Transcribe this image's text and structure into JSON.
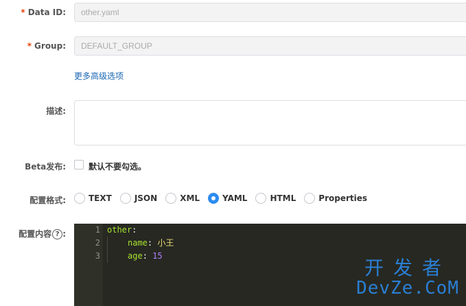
{
  "form": {
    "data_id": {
      "required_mark": "*",
      "label": "Data ID:",
      "value": "other.yaml"
    },
    "group": {
      "required_mark": "*",
      "label": "Group:",
      "value": "DEFAULT_GROUP"
    },
    "advanced_link": "更多高级选项",
    "description": {
      "label": "描述:"
    },
    "beta": {
      "label": "Beta发布:",
      "checkbox_label": "默认不要勾选。",
      "checked": false
    },
    "format": {
      "label": "配置格式:",
      "options": [
        "TEXT",
        "JSON",
        "XML",
        "YAML",
        "HTML",
        "Properties"
      ],
      "selected": "YAML"
    },
    "content": {
      "label": "配置内容",
      "help_icon": "question-circle-icon",
      "lines": [
        {
          "no": "1",
          "key": "other",
          "sep": ":",
          "value": ""
        },
        {
          "no": "2",
          "key": "name",
          "sep": ": ",
          "value": "小王"
        },
        {
          "no": "3",
          "key": "age",
          "sep": ": ",
          "value": "15"
        }
      ]
    }
  },
  "watermark": {
    "cn": "开发者",
    "en": "DevZe.CoM"
  },
  "colors": {
    "accent": "#2d8cf0",
    "required": "#e8440a",
    "link": "#1a66b3",
    "editor_bg": "#272822"
  }
}
